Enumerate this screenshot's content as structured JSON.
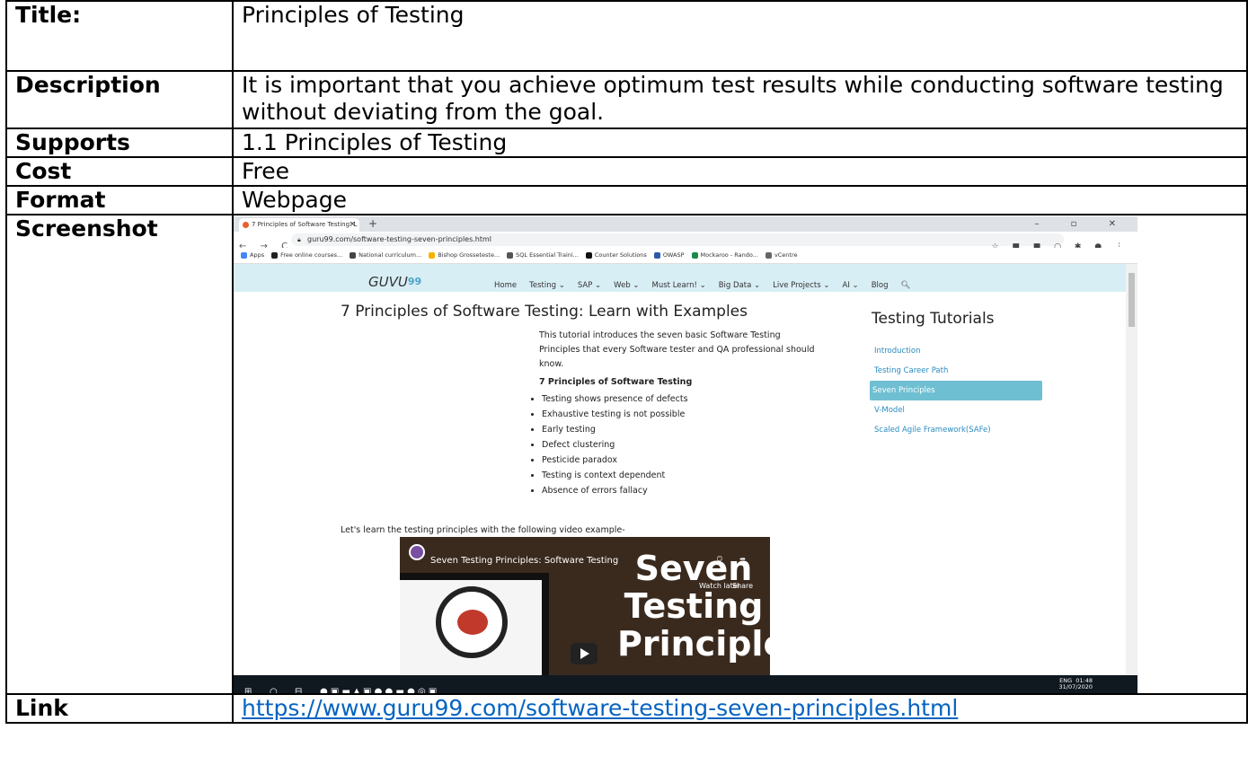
{
  "table": {
    "title_label": "Title:",
    "title_value": "Principles of Testing",
    "description_label": "Description",
    "description_value": "It is important that you achieve optimum test results while conducting software testing without deviating from the goal.",
    "supports_label": "Supports",
    "supports_value": "1.1 Principles of Testing",
    "cost_label": "Cost",
    "cost_value": "Free",
    "format_label": "Format",
    "format_value": "Webpage",
    "screenshot_label": "Screenshot",
    "link_label": "Link",
    "link_value": "https://www.guru99.com/software-testing-seven-principles.html"
  },
  "shot": {
    "tab_title": "7 Principles of Software Testing: L",
    "tab_close": "×",
    "new_tab": "+",
    "window_controls": "–  ▫  ✕",
    "nav_buttons": "← → C",
    "url": "guru99.com/software-testing-seven-principles.html",
    "bookmarks": [
      "Apps",
      "Free online courses...",
      "National curriculum...",
      "Bishop Grosseteste...",
      "SQL Essential Traini...",
      "Counter Solutions",
      "OWASP",
      "Mockaroo - Rando...",
      "vCentre"
    ],
    "bookmark_colors": [
      "#4285f4",
      "#222222",
      "#444444",
      "#f4b400",
      "#555555",
      "#111111",
      "#2a5aa8",
      "#1a8a4a",
      "#666666"
    ],
    "logo": "GUVU",
    "logo_sup": "99",
    "menu": [
      "Home",
      "Testing ⌄",
      "SAP ⌄",
      "Web ⌄",
      "Must Learn! ⌄",
      "Big Data ⌄",
      "Live Projects ⌄",
      "AI ⌄",
      "Blog",
      "🔍︎"
    ],
    "page_title": "7 Principles of Software Testing: Learn with Examples",
    "intro": "This tutorial introduces the seven basic Software Testing Principles that every Software tester and QA professional should know.",
    "subheading": "7 Principles of Software Testing",
    "principles": [
      "Testing shows presence of defects",
      "Exhaustive testing is not possible",
      "Early testing",
      "Defect clustering",
      "Pesticide paradox",
      "Testing is context dependent",
      "Absence of errors fallacy"
    ],
    "lets_learn": "Let's learn the testing principles with the following video example-",
    "sidebar_title": "Testing Tutorials",
    "sidebar_items": [
      "Introduction",
      "Testing Career Path",
      "Seven Principles",
      "V-Model",
      "Scaled Agile Framework(SAFe)"
    ],
    "video_title": "Seven Testing Principles: Software Testing",
    "video_big_text": "Seven Testing Principles",
    "watch_later": "Watch later",
    "share": "Share",
    "tray_lang": "ENG",
    "tray_time": "01:48",
    "tray_date": "31/07/2020"
  },
  "colors": {
    "link": "#0563c1",
    "site_header": "#d8eef5",
    "sidebar_active": "#6fbfd2",
    "sidebar_link": "#2a8bc0",
    "taskbar": "#101820"
  }
}
